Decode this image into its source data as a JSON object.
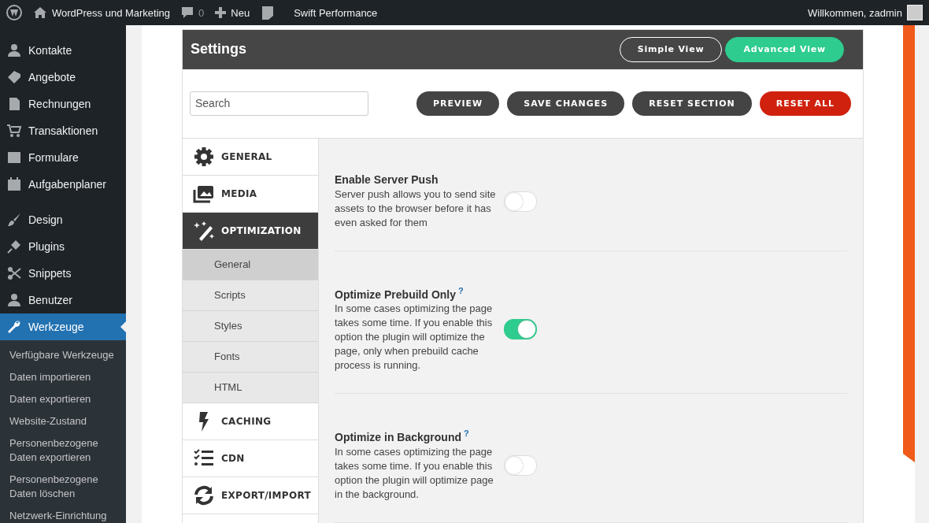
{
  "admin_bar": {
    "site_name": "WordPress und Marketing",
    "comments_count": "0",
    "new_label": "Neu",
    "plugin_label": "Swift Performance",
    "greeting": "Willkommen, zadmin"
  },
  "sidebar": {
    "groups": [
      {
        "items": [
          {
            "label": "Kontakte",
            "selected": false
          },
          {
            "label": "Angebote",
            "selected": false
          },
          {
            "label": "Rechnungen",
            "selected": false
          },
          {
            "label": "Transaktionen",
            "selected": false
          },
          {
            "label": "Formulare",
            "selected": false
          },
          {
            "label": "Aufgabenplaner",
            "selected": false
          }
        ]
      },
      {
        "items": [
          {
            "label": "Design",
            "selected": false
          },
          {
            "label": "Plugins",
            "selected": false
          },
          {
            "label": "Snippets",
            "selected": false
          },
          {
            "label": "Benutzer",
            "selected": false
          },
          {
            "label": "Werkzeuge",
            "selected": true
          }
        ]
      }
    ],
    "submenu": [
      "Verfügbare Werkzeuge",
      "Daten importieren",
      "Daten exportieren",
      "Website-Zustand",
      "Personenbezogene Daten exportieren",
      "Personenbezogene Daten löschen",
      "Netzwerk-Einrichtung"
    ]
  },
  "panel": {
    "title": "Settings",
    "view_buttons": [
      {
        "label": "Simple View",
        "selected": false
      },
      {
        "label": "Advanced View",
        "selected": true
      }
    ],
    "search": {
      "placeholder": "Search"
    },
    "actions": [
      {
        "label": "PREVIEW",
        "kind": "default"
      },
      {
        "label": "SAVE CHANGES",
        "kind": "default"
      },
      {
        "label": "RESET SECTION",
        "kind": "default"
      },
      {
        "label": "RESET ALL",
        "kind": "danger"
      }
    ],
    "sections": [
      {
        "label": "GENERAL",
        "selected": false
      },
      {
        "label": "MEDIA",
        "selected": false
      },
      {
        "label": "OPTIMIZATION",
        "selected": true,
        "children": [
          {
            "label": "General",
            "selected": true
          },
          {
            "label": "Scripts",
            "selected": false
          },
          {
            "label": "Styles",
            "selected": false
          },
          {
            "label": "Fonts",
            "selected": false
          },
          {
            "label": "HTML",
            "selected": false
          }
        ]
      },
      {
        "label": "CACHING",
        "selected": false
      },
      {
        "label": "CDN",
        "selected": false
      },
      {
        "label": "EXPORT/IMPORT",
        "selected": false
      }
    ],
    "settings": [
      {
        "title": "Enable Server Push",
        "description": "Server push allows you to send site assets to the browser before it has even asked for them",
        "on": false
      },
      {
        "title": "Optimize Prebuild Only",
        "help": "?",
        "description": "In some cases optimizing the page takes some time. If you enable this option the plugin will optimize the page, only when prebuild cache process is running.",
        "on": true
      },
      {
        "title": "Optimize in Background",
        "help": "?",
        "description": "In some cases optimizing the page takes some time. If you enable this option the plugin will optimize page in the background.",
        "on": false
      }
    ]
  }
}
